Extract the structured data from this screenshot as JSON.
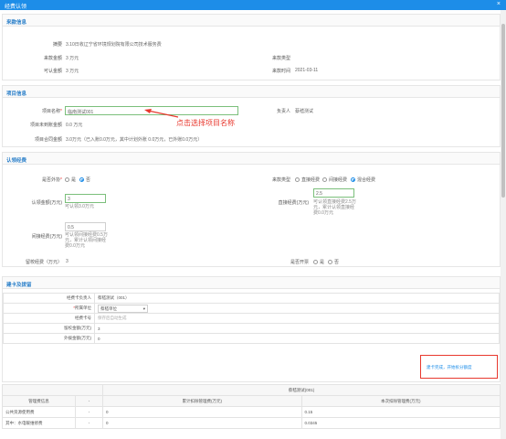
{
  "window": {
    "title": "经费认领",
    "close": "×"
  },
  "income": {
    "section_title": "来款信息",
    "summary_label": "摘要",
    "summary_value": "3.10日收辽宁省环境规划院有限公司技术服务费",
    "amount_label": "来款金额",
    "amount_value": "3 万元",
    "type_label": "来款类型",
    "type_value": "",
    "claimable_label": "可认金额",
    "claimable_value": "3 万元",
    "time_label": "来款时间",
    "time_value": "2021-03-11"
  },
  "project": {
    "section_title": "项目信息",
    "name_label": "项目名称",
    "name_value": "临南测试001",
    "leader_label": "负责人",
    "leader_value": "蔡嵇测试",
    "annotation": "点击选择项目名称",
    "unclaimed_label": "项目未到账金额",
    "unclaimed_value": "0.0 万元",
    "contract_label": "项目合同金额",
    "contract_value": "3.0万元（已入账0.0万元，其中计划外账 0.0万元，已外账0.0万元）"
  },
  "claim": {
    "section_title": "认领经费",
    "outsourced_label": "是否外协",
    "outsourced_options": [
      "是",
      "否"
    ],
    "outsourced_selected": 1,
    "fund_type_label": "来款类型",
    "fund_type_options": [
      "直接经费",
      "间接经费",
      "混合经费"
    ],
    "fund_type_selected": 2,
    "claim_amount_label": "认领金额(万元)",
    "claim_amount_value": "3",
    "claim_amount_hint": "可认领3.0万元",
    "direct_label": "直接经费(万元)",
    "direct_value": "2.5",
    "direct_hint": "可认领直接经费2.5万元，累计认领直接经费0.0万元",
    "indirect_label": "间接经费(万元)",
    "indirect_value": "0.5",
    "indirect_hint": "可认领间接经费0.5万元，累计认领间接经费0.0万元",
    "school_label": "留校经费（万元）",
    "school_value": "3",
    "invoice_label": "是否开票",
    "invoice_options": [
      "是",
      "否"
    ],
    "invoice_selected": -1
  },
  "card": {
    "section_title": "建卡及拨留",
    "holder_label": "经费卡负责人",
    "holder_value": "蔡嵇测试（001）",
    "unit_label": "所属单位",
    "unit_value": "蔡嵇单位",
    "cardno_label": "经费卡号",
    "cardno_placeholder": "保存后自动生成",
    "school_label": "留校金额(万元)",
    "school_value": "3",
    "out_label": "外拨金额(万元)",
    "out_value": "0",
    "action_button": "建卡完成，开始拆分额度"
  },
  "bottom_table": {
    "group_header": "蔡嵇测试(001)",
    "headers": [
      "管理费信息",
      "-",
      "累计扣除管理费(万元)",
      "本次扣除管理费(万元)"
    ],
    "rows": [
      [
        "公共资源使用费",
        "-",
        "0",
        "0.15"
      ],
      [
        "其中：水电暖维修费",
        "-",
        "0",
        "0.0345"
      ]
    ]
  }
}
